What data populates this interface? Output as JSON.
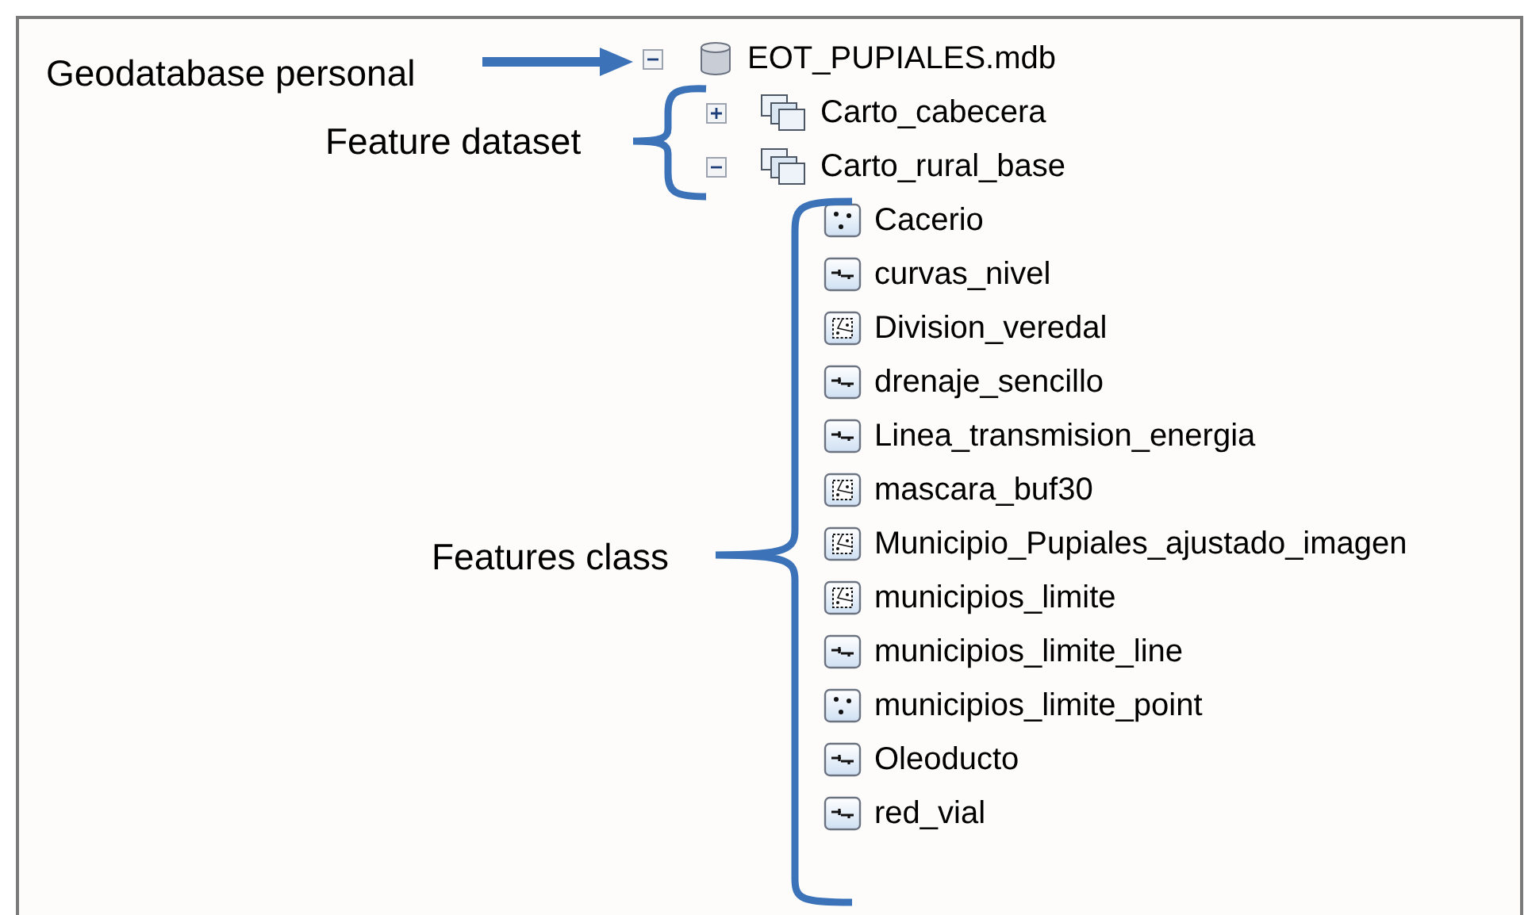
{
  "tree": [
    {
      "label": "EOT_PUPIALES.mdb",
      "kind": "geodatabase",
      "expanded": true,
      "children": [
        {
          "label": "Carto_cabecera",
          "kind": "dataset",
          "expanded": false
        },
        {
          "label": "Carto_rural_base",
          "kind": "dataset",
          "expanded": true,
          "children": [
            {
              "label": "Cacerio",
              "kind": "point"
            },
            {
              "label": "curvas_nivel",
              "kind": "line"
            },
            {
              "label": "Division_veredal",
              "kind": "polygon"
            },
            {
              "label": "drenaje_sencillo",
              "kind": "line"
            },
            {
              "label": "Linea_transmision_energia",
              "kind": "line"
            },
            {
              "label": "mascara_buf30",
              "kind": "polygon"
            },
            {
              "label": "Municipio_Pupiales_ajustado_imagen",
              "kind": "polygon"
            },
            {
              "label": "municipios_limite",
              "kind": "polygon"
            },
            {
              "label": "municipios_limite_line",
              "kind": "line"
            },
            {
              "label": "municipios_limite_point",
              "kind": "point"
            },
            {
              "label": "Oleoducto",
              "kind": "line"
            },
            {
              "label": "red_vial",
              "kind": "line"
            }
          ]
        }
      ]
    }
  ],
  "annotations": [
    {
      "text": "Geodatabase personal",
      "kind": "arrow"
    },
    {
      "text": "Feature dataset",
      "kind": "brace-small"
    },
    {
      "text": "Features class",
      "kind": "brace-large"
    }
  ]
}
